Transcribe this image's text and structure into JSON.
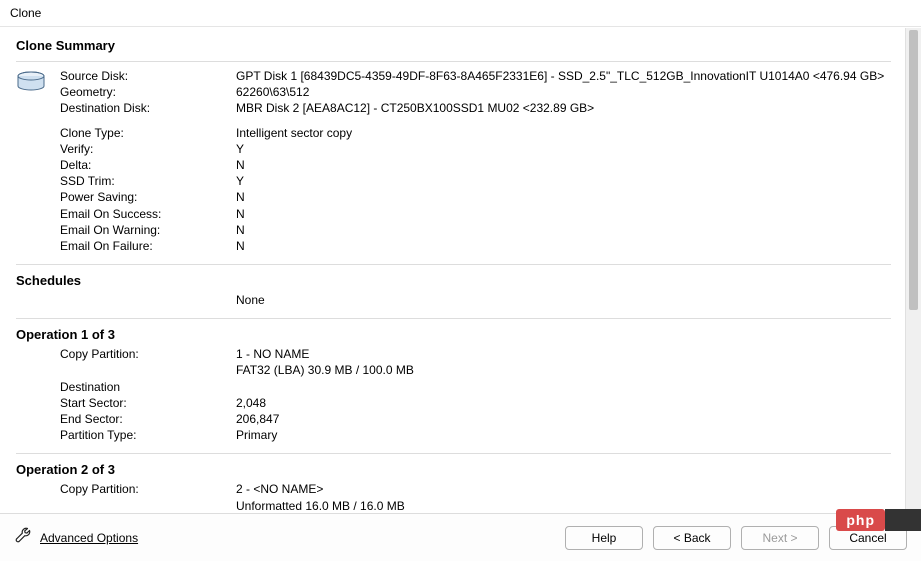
{
  "window": {
    "title": "Clone"
  },
  "summary": {
    "heading": "Clone Summary",
    "labels": {
      "source_disk": "Source Disk:",
      "geometry": "Geometry:",
      "destination_disk": "Destination Disk:",
      "clone_type": "Clone Type:",
      "verify": "Verify:",
      "delta": "Delta:",
      "ssd_trim": "SSD Trim:",
      "power_saving": "Power Saving:",
      "email_success": "Email On Success:",
      "email_warning": "Email On Warning:",
      "email_failure": "Email On Failure:"
    },
    "values": {
      "source_disk": "GPT Disk 1 [68439DC5-4359-49DF-8F63-8A465F2331E6] - SSD_2.5\"_TLC_512GB_InnovationIT U1014A0  <476.94 GB>",
      "geometry": "62260\\63\\512",
      "destination_disk": "MBR Disk 2 [AEA8AC12] - CT250BX100SSD1 MU02  <232.89 GB>",
      "clone_type": "Intelligent sector copy",
      "verify": "Y",
      "delta": "N",
      "ssd_trim": "Y",
      "power_saving": "N",
      "email_success": "N",
      "email_warning": "N",
      "email_failure": "N"
    }
  },
  "schedules": {
    "heading": "Schedules",
    "value": "None"
  },
  "operations": [
    {
      "heading": "Operation 1 of 3",
      "labels": {
        "copy_partition": "Copy Partition:",
        "destination": "Destination",
        "start_sector": "Start Sector:",
        "end_sector": "End Sector:",
        "partition_type": "Partition Type:"
      },
      "values": {
        "copy_partition": "1 - NO NAME",
        "copy_sub": "FAT32 (LBA) 30.9 MB / 100.0 MB",
        "start_sector": "2,048",
        "end_sector": "206,847",
        "partition_type": "Primary"
      }
    },
    {
      "heading": "Operation 2 of 3",
      "labels": {
        "copy_partition": "Copy Partition:"
      },
      "values": {
        "copy_partition": "2 - <NO NAME>",
        "copy_sub": "Unformatted 16.0 MB / 16.0 MB"
      }
    }
  ],
  "footer": {
    "advanced": "Advanced Options",
    "help": "Help",
    "back": "< Back",
    "next": "Next >",
    "cancel": "Cancel"
  },
  "badge": {
    "php": "php"
  }
}
